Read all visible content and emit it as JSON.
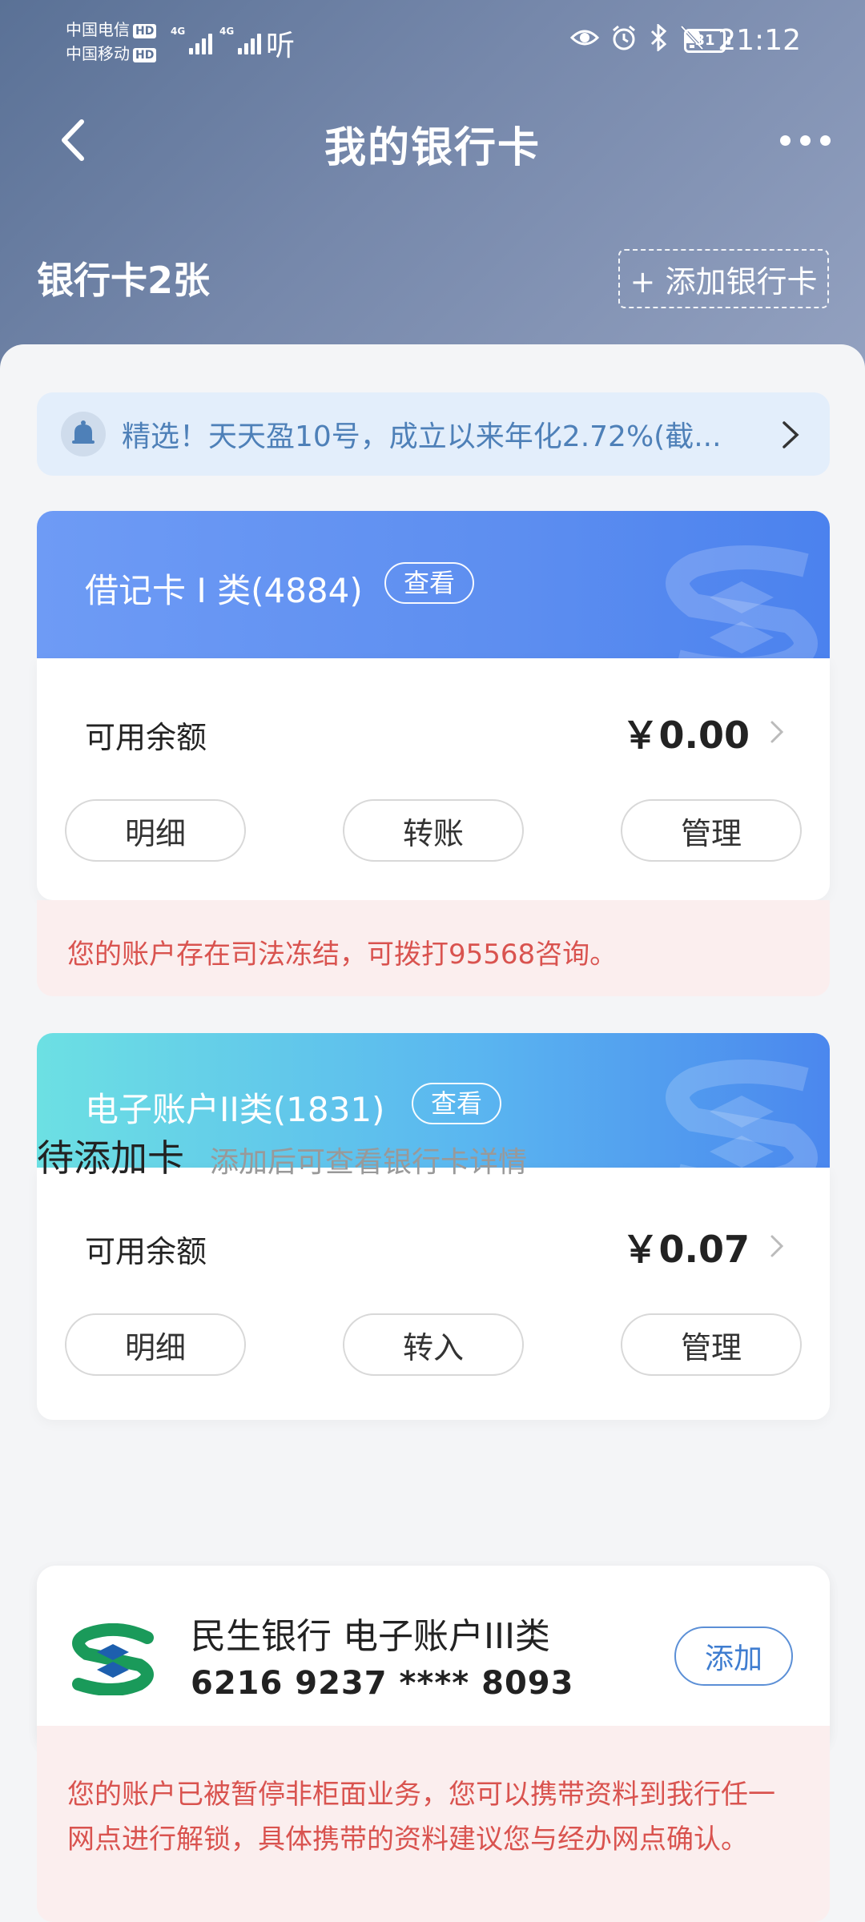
{
  "status_bar": {
    "carrier1": "中国电信",
    "carrier2": "中国移动",
    "hd_label": "HD",
    "signal_label": "4G",
    "listen": "听",
    "battery": "31",
    "time": "21:12"
  },
  "header": {
    "title": "我的银行卡",
    "card_count": "银行卡2张",
    "add_card": "+ 添加银行卡"
  },
  "notice": {
    "text": "精选！天天盈10号，成立以来年化2.72%(截..."
  },
  "cards": [
    {
      "title": "借记卡 I 类(4884)",
      "view": "查看",
      "balance_label": "可用余额",
      "balance": "￥0.00",
      "actions": [
        "明细",
        "转账",
        "管理"
      ],
      "warning": "您的账户存在司法冻结，可拨打95568咨询。"
    },
    {
      "title": "电子账户II类(1831)",
      "view": "查看",
      "balance_label": "可用余额",
      "balance": "￥0.07",
      "actions": [
        "明细",
        "转入",
        "管理"
      ]
    }
  ],
  "pending": {
    "title": "待添加卡",
    "subtitle": "添加后可查看银行卡详情",
    "bank_name": "民生银行 电子账户III类",
    "card_number": "6216 9237 **** 8093",
    "add": "添加",
    "warning": "您的账户已被暂停非柜面业务，您可以携带资料到我行任一网点进行解锁，具体携带的资料建议您与经办网点确认。"
  },
  "colors": {
    "header_bg": "#5a7196",
    "debit_card": "#5d8ef0",
    "e_account_card": "#5ab6f0",
    "warning_text": "#d9534f",
    "notice_text": "#4e80b8",
    "brand_green": "#1a9a5a",
    "brand_blue": "#1d5fae"
  }
}
